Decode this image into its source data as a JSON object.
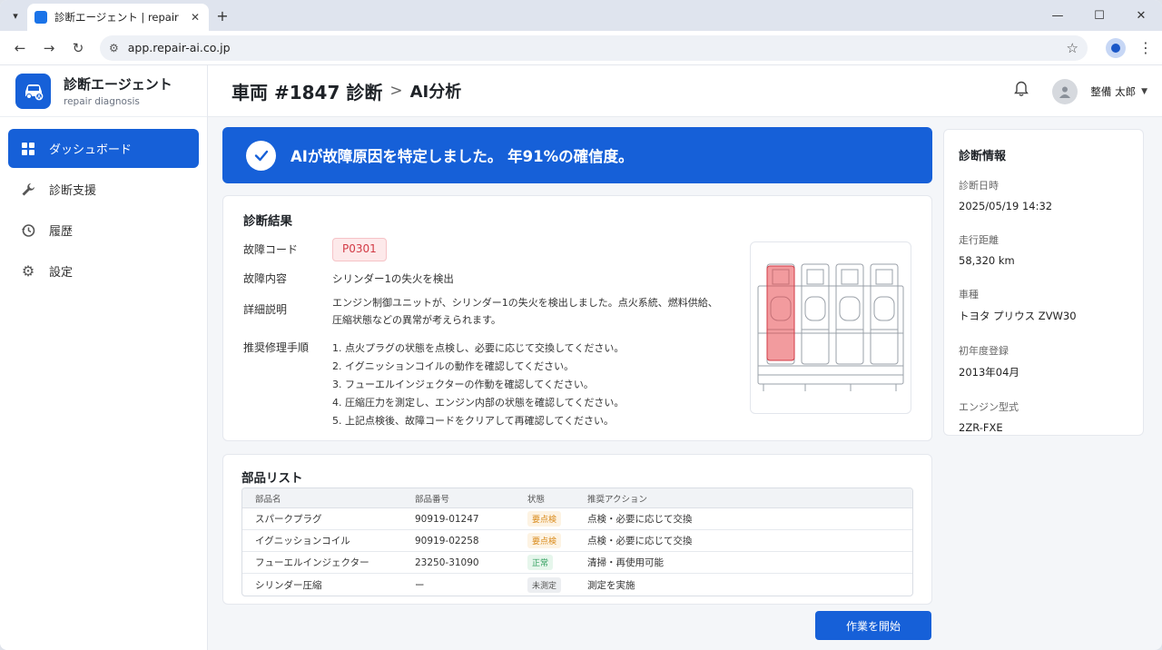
{
  "browser": {
    "tab_title": "診断エージェント | repair diagnosis",
    "url": "app.repair-ai.co.jp"
  },
  "brand": {
    "name": "診断エージェント",
    "sub": "repair diagnosis"
  },
  "sidebar": {
    "items": [
      {
        "label": "ダッシュボード",
        "icon": "dashboard-icon",
        "active": true
      },
      {
        "label": "診断支援",
        "icon": "wrench-icon",
        "active": false
      },
      {
        "label": "履歴",
        "icon": "history-icon",
        "active": false
      },
      {
        "label": "設定",
        "icon": "gear-icon",
        "active": false
      }
    ]
  },
  "header": {
    "title": "車両 #1847 診断",
    "sep": ">",
    "sub": "AI分析",
    "user": "整備 太郎"
  },
  "banner": {
    "text": "AIが故障原因を特定しました。 年91%の確信度。"
  },
  "result": {
    "title": "診断結果",
    "code_label": "故障コード",
    "code": "P0301",
    "content_label": "故障内容",
    "content": "シリンダー1の失火を検出",
    "detail_label": "詳細説明",
    "detail_line1": "エンジン制御ユニットが、シリンダー1の失火を検出しました。点火系統、燃料供給、",
    "detail_line2": "圧縮状態などの異常が考えられます。",
    "steps_label": "推奨修理手順",
    "steps": [
      "1. 点火プラグの状態を点検し、必要に応じて交換してください。",
      "2. イグニッションコイルの動作を確認してください。",
      "3. フューエルインジェクターの作動を確認してください。",
      "4. 圧縮圧力を測定し、エンジン内部の状態を確認してください。",
      "5. 上記点検後、故障コードをクリアして再確認してください。"
    ]
  },
  "parts": {
    "title": "部品リスト",
    "headers": [
      "部品名",
      "部品番号",
      "状態",
      "推奨アクション"
    ],
    "rows": [
      {
        "name": "スパークプラグ",
        "number": "90919-01247",
        "status": "要点検",
        "action": "点検・必要に応じて交換"
      },
      {
        "name": "イグニッションコイル",
        "number": "90919-02258",
        "status": "要点検",
        "action": "点検・必要に応じて交換"
      },
      {
        "name": "フューエルインジェクター",
        "number": "23250-31090",
        "status": "正常",
        "action": "清掃・再使用可能"
      },
      {
        "name": "シリンダー圧縮",
        "number": "ー",
        "status": "未測定",
        "action": "測定を実施"
      }
    ]
  },
  "start_button": "作業を開始",
  "info": {
    "title": "診断情報",
    "fields": [
      {
        "label": "診断日時",
        "value": "2025/05/19 14:32"
      },
      {
        "label": "走行距離",
        "value": "58,320 km"
      },
      {
        "label": "車種",
        "value": "トヨタ プリウス ZVW30"
      },
      {
        "label": "初年度登録",
        "value": "2013年04月"
      },
      {
        "label": "エンジン型式",
        "value": "2ZR-FXE"
      }
    ]
  },
  "colors": {
    "accent": "#1660d8",
    "danger": "#d23a45",
    "warn": "#e6a23c",
    "ok": "#2e9e5b"
  }
}
